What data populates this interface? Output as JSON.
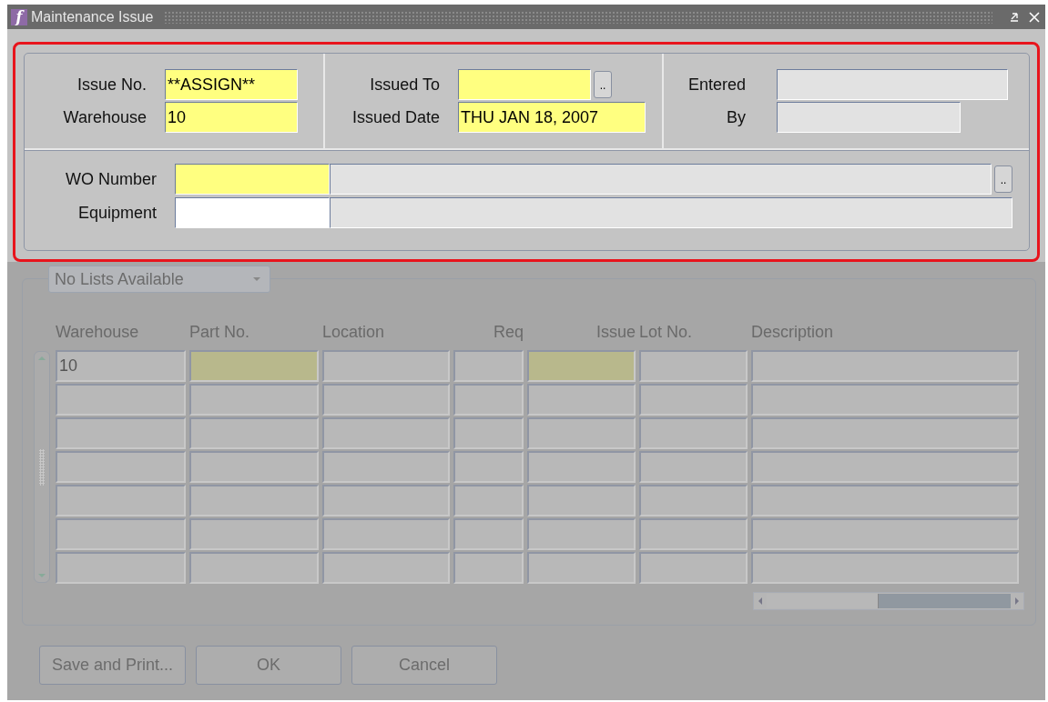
{
  "window": {
    "title": "Maintenance Issue",
    "icon_letter": "f"
  },
  "header": {
    "highlighted": true,
    "sections": [
      {
        "fields": [
          {
            "label": "Issue No.",
            "value": "**ASSIGN**",
            "kind": "required"
          },
          {
            "label": "Warehouse",
            "value": "10",
            "kind": "required"
          }
        ]
      },
      {
        "fields": [
          {
            "label": "Issued To",
            "kind": "required",
            "lookup_button": ".."
          },
          {
            "label": "Issued Date",
            "value": "THU JAN 18, 2007",
            "kind": "required"
          }
        ]
      },
      {
        "fields": [
          {
            "label": "Entered",
            "kind": "readonly"
          },
          {
            "label": "By",
            "kind": "readonly"
          }
        ]
      }
    ],
    "wide_fields": [
      {
        "label": "WO Number",
        "kind": "required",
        "lookup_button": ".."
      },
      {
        "label": "Equipment",
        "kind": "optional"
      }
    ]
  },
  "lines": {
    "disabled": true,
    "list_selector": "No Lists Available",
    "columns": [
      {
        "label": "Warehouse",
        "kind": "text",
        "required": false
      },
      {
        "label": "Part No.",
        "kind": "text",
        "required": true
      },
      {
        "label": "Location",
        "kind": "text",
        "required": false
      },
      {
        "label": "Req",
        "kind": "number",
        "required": false
      },
      {
        "label": "Issue",
        "kind": "number",
        "required": true
      },
      {
        "label": "Lot No.",
        "kind": "text",
        "required": false
      },
      {
        "label": "Description",
        "kind": "text",
        "required": false
      }
    ],
    "rows": [
      {
        "current": true,
        "cells": [
          "10"
        ]
      },
      {
        "current": false,
        "cells": []
      },
      {
        "current": false,
        "cells": []
      },
      {
        "current": false,
        "cells": []
      },
      {
        "current": false,
        "cells": []
      },
      {
        "current": false,
        "cells": []
      },
      {
        "current": false,
        "cells": []
      }
    ]
  },
  "buttons": [
    "Save and Print...",
    "OK",
    "Cancel"
  ]
}
